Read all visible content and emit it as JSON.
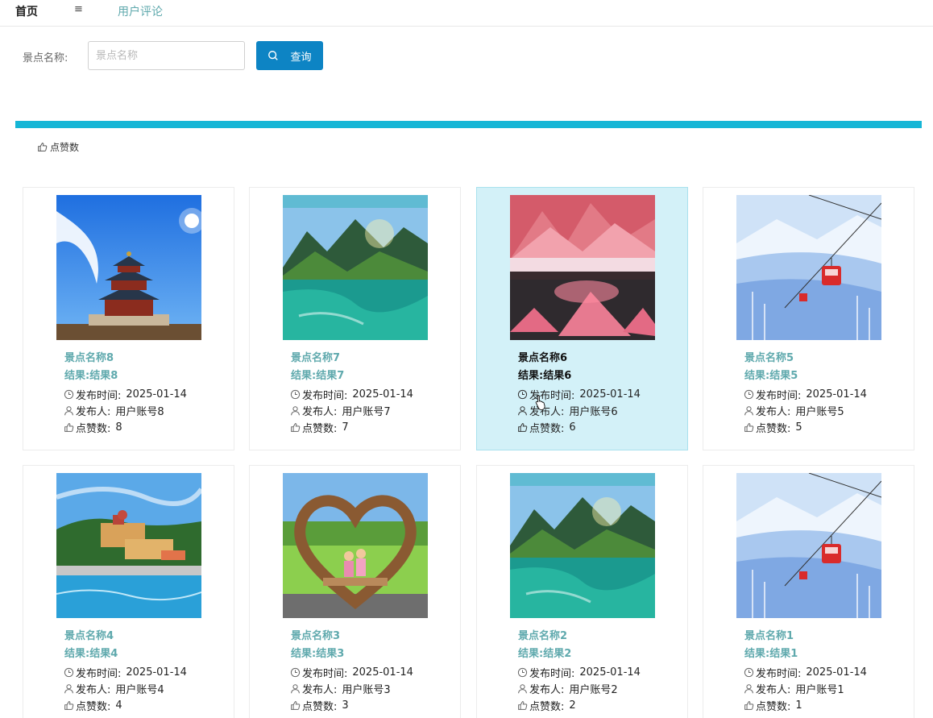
{
  "nav": {
    "home": "首页",
    "menu_icon": "≡",
    "tab": "用户评论"
  },
  "search": {
    "label": "景点名称:",
    "placeholder": "景点名称",
    "value": "",
    "button_label": "查询"
  },
  "sort": {
    "like_label": "点赞数"
  },
  "colors": {
    "accent": "#16b6d6",
    "button": "#0d84c4",
    "title": "#5fa9ad",
    "active_card": "#d3f1f8"
  },
  "cards": [
    {
      "name": "景点名称8",
      "result": "结果:结果8",
      "time_label": "发布时间:",
      "time": "2025-01-14",
      "publisher_label": "发布人:",
      "publisher": "用户账号8",
      "likes_label": "点赞数:",
      "likes": "8",
      "image": "temple-of-heaven"
    },
    {
      "name": "景点名称7",
      "result": "结果:结果7",
      "time_label": "发布时间:",
      "time": "2025-01-14",
      "publisher_label": "发布人:",
      "publisher": "用户账号7",
      "likes_label": "点赞数:",
      "likes": "7",
      "image": "mountain-lake"
    },
    {
      "name": "景点名称6",
      "result": "结果:结果6",
      "time_label": "发布时间:",
      "time": "2025-01-14",
      "publisher_label": "发布人:",
      "publisher": "用户账号6",
      "likes_label": "点赞数:",
      "likes": "6",
      "image": "pink-mountains",
      "active": true
    },
    {
      "name": "景点名称5",
      "result": "结果:结果5",
      "time_label": "发布时间:",
      "time": "2025-01-14",
      "publisher_label": "发布人:",
      "publisher": "用户账号5",
      "likes_label": "点赞数:",
      "likes": "5",
      "image": "snow-cable-car"
    },
    {
      "name": "景点名称4",
      "result": "结果:结果4",
      "time_label": "发布时间:",
      "time": "2025-01-14",
      "publisher_label": "发布人:",
      "publisher": "用户账号4",
      "likes_label": "点赞数:",
      "likes": "4",
      "image": "seaside-palace"
    },
    {
      "name": "景点名称3",
      "result": "结果:结果3",
      "time_label": "发布时间:",
      "time": "2025-01-14",
      "publisher_label": "发布人:",
      "publisher": "用户账号3",
      "likes_label": "点赞数:",
      "likes": "3",
      "image": "heart-frame-kids"
    },
    {
      "name": "景点名称2",
      "result": "结果:结果2",
      "time_label": "发布时间:",
      "time": "2025-01-14",
      "publisher_label": "发布人:",
      "publisher": "用户账号2",
      "likes_label": "点赞数:",
      "likes": "2",
      "image": "mountain-lake"
    },
    {
      "name": "景点名称1",
      "result": "结果:结果1",
      "time_label": "发布时间:",
      "time": "2025-01-14",
      "publisher_label": "发布人:",
      "publisher": "用户账号1",
      "likes_label": "点赞数:",
      "likes": "1",
      "image": "snow-cable-car"
    }
  ]
}
